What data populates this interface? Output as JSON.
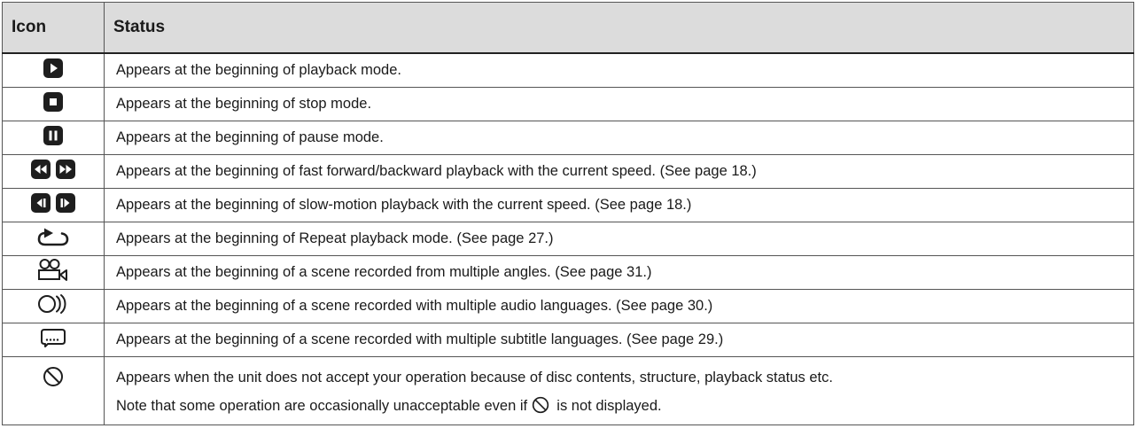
{
  "table": {
    "header_icon": "Icon",
    "header_status": "Status",
    "rows": [
      {
        "icon": "play-icon",
        "status": "Appears at the beginning of playback mode."
      },
      {
        "icon": "stop-icon",
        "status": "Appears at the beginning of stop mode."
      },
      {
        "icon": "pause-icon",
        "status": "Appears at the beginning of pause mode."
      },
      {
        "icon": "fast-backward-forward-icon",
        "status": "Appears at the beginning of fast forward/backward playback with the current speed. (See page 18.)"
      },
      {
        "icon": "slow-backward-forward-icon",
        "status": "Appears at the beginning of slow-motion playback with the current speed. (See page 18.)"
      },
      {
        "icon": "repeat-icon",
        "status": "Appears at the beginning of Repeat playback mode. (See page 27.)"
      },
      {
        "icon": "angle-camera-icon",
        "status": "Appears at the beginning of a scene recorded from multiple angles. (See page 31.)"
      },
      {
        "icon": "audio-icon",
        "status": "Appears at the beginning of a scene recorded with multiple audio languages. (See page 30.)"
      },
      {
        "icon": "subtitle-icon",
        "status": "Appears at the beginning of a scene recorded with multiple subtitle languages. (See page 29.)"
      },
      {
        "icon": "prohibited-icon",
        "status": "Appears when the unit does not accept your operation because of disc contents, structure, playback status etc.",
        "note_before": "Note that some operation are occasionally unacceptable even if",
        "note_after": " is not displayed."
      }
    ]
  }
}
